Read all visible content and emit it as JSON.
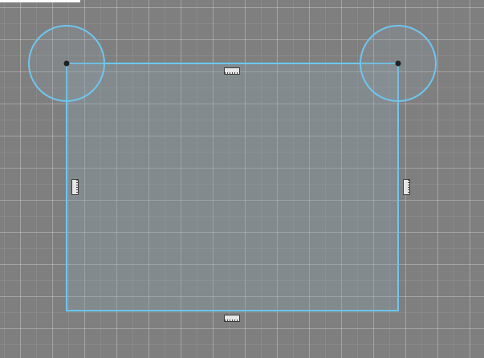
{
  "canvas": {
    "background_color": "#7f7f7f",
    "grid_visible": true
  },
  "selection": {
    "shape": "rectangle",
    "stroke_color": "#6ec6f0",
    "fill_color": "rgba(140,160,170,0.35)",
    "corner_radius_handles_icon": "circle-radius-handle",
    "corner_point_icon": "dot-vertex-icon",
    "edge_handle_icon": "ruler-handle-icon"
  }
}
